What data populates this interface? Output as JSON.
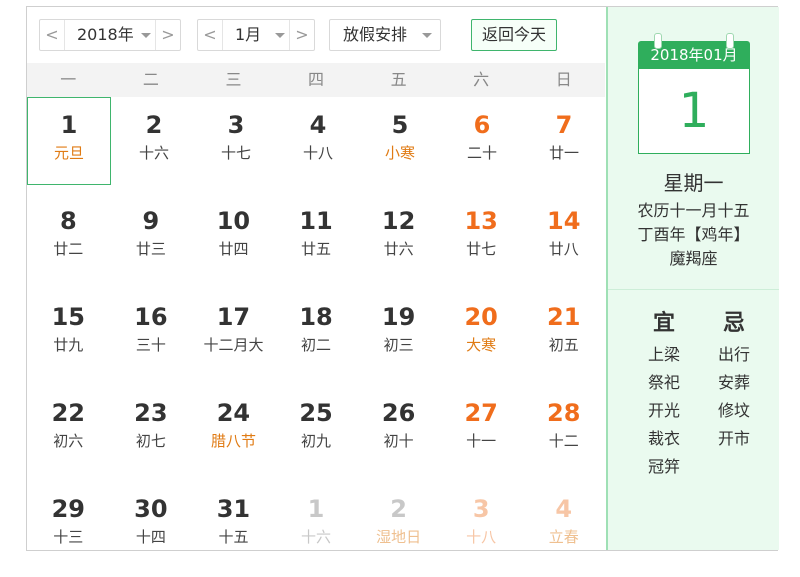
{
  "toolbar": {
    "year_value": "2018年",
    "month_value": "1月",
    "holiday_label": "放假安排",
    "today_label": "返回今天",
    "prev_glyph": "<",
    "next_glyph": ">"
  },
  "weekdays": [
    "一",
    "二",
    "三",
    "四",
    "五",
    "六",
    "日"
  ],
  "weeks": [
    [
      {
        "d": "1",
        "s": "元旦",
        "fest": true,
        "we": false,
        "other": false,
        "selected": true
      },
      {
        "d": "2",
        "s": "十六",
        "fest": false,
        "we": false,
        "other": false
      },
      {
        "d": "3",
        "s": "十七",
        "fest": false,
        "we": false,
        "other": false
      },
      {
        "d": "4",
        "s": "十八",
        "fest": false,
        "we": false,
        "other": false
      },
      {
        "d": "5",
        "s": "小寒",
        "fest": true,
        "we": false,
        "other": false
      },
      {
        "d": "6",
        "s": "二十",
        "fest": false,
        "we": true,
        "other": false
      },
      {
        "d": "7",
        "s": "廿一",
        "fest": false,
        "we": true,
        "other": false
      }
    ],
    [
      {
        "d": "8",
        "s": "廿二",
        "fest": false,
        "we": false,
        "other": false
      },
      {
        "d": "9",
        "s": "廿三",
        "fest": false,
        "we": false,
        "other": false
      },
      {
        "d": "10",
        "s": "廿四",
        "fest": false,
        "we": false,
        "other": false
      },
      {
        "d": "11",
        "s": "廿五",
        "fest": false,
        "we": false,
        "other": false
      },
      {
        "d": "12",
        "s": "廿六",
        "fest": false,
        "we": false,
        "other": false
      },
      {
        "d": "13",
        "s": "廿七",
        "fest": false,
        "we": true,
        "other": false
      },
      {
        "d": "14",
        "s": "廿八",
        "fest": false,
        "we": true,
        "other": false
      }
    ],
    [
      {
        "d": "15",
        "s": "廿九",
        "fest": false,
        "we": false,
        "other": false
      },
      {
        "d": "16",
        "s": "三十",
        "fest": false,
        "we": false,
        "other": false
      },
      {
        "d": "17",
        "s": "十二月大",
        "fest": false,
        "we": false,
        "other": false
      },
      {
        "d": "18",
        "s": "初二",
        "fest": false,
        "we": false,
        "other": false
      },
      {
        "d": "19",
        "s": "初三",
        "fest": false,
        "we": false,
        "other": false
      },
      {
        "d": "20",
        "s": "大寒",
        "fest": true,
        "we": true,
        "other": false
      },
      {
        "d": "21",
        "s": "初五",
        "fest": false,
        "we": true,
        "other": false
      }
    ],
    [
      {
        "d": "22",
        "s": "初六",
        "fest": false,
        "we": false,
        "other": false
      },
      {
        "d": "23",
        "s": "初七",
        "fest": false,
        "we": false,
        "other": false
      },
      {
        "d": "24",
        "s": "腊八节",
        "fest": true,
        "we": false,
        "other": false
      },
      {
        "d": "25",
        "s": "初九",
        "fest": false,
        "we": false,
        "other": false
      },
      {
        "d": "26",
        "s": "初十",
        "fest": false,
        "we": false,
        "other": false
      },
      {
        "d": "27",
        "s": "十一",
        "fest": false,
        "we": true,
        "other": false
      },
      {
        "d": "28",
        "s": "十二",
        "fest": false,
        "we": true,
        "other": false
      }
    ],
    [
      {
        "d": "29",
        "s": "十三",
        "fest": false,
        "we": false,
        "other": false
      },
      {
        "d": "30",
        "s": "十四",
        "fest": false,
        "we": false,
        "other": false
      },
      {
        "d": "31",
        "s": "十五",
        "fest": false,
        "we": false,
        "other": false
      },
      {
        "d": "1",
        "s": "十六",
        "fest": false,
        "we": false,
        "other": true
      },
      {
        "d": "2",
        "s": "湿地日",
        "fest": true,
        "we": false,
        "other": true
      },
      {
        "d": "3",
        "s": "十八",
        "fest": false,
        "we": true,
        "other": true
      },
      {
        "d": "4",
        "s": "立春",
        "fest": true,
        "we": true,
        "other": true
      }
    ]
  ],
  "panel": {
    "icon_header": "2018年01月",
    "icon_day": "1",
    "weekday": "星期一",
    "lunar": "农历十一月十五",
    "ganzhi": "丁酉年【鸡年】",
    "zodiac": "魔羯座",
    "yi_title": "宜",
    "yi_items": [
      "上梁",
      "祭祀",
      "开光",
      "裁衣",
      "冠笄"
    ],
    "ji_title": "忌",
    "ji_items": [
      "出行",
      "安葬",
      "修坟",
      "开市"
    ]
  },
  "colors": {
    "accent_green": "#2fae5c",
    "weekend_orange": "#f06d1c",
    "festival_orange": "#e07b14"
  }
}
